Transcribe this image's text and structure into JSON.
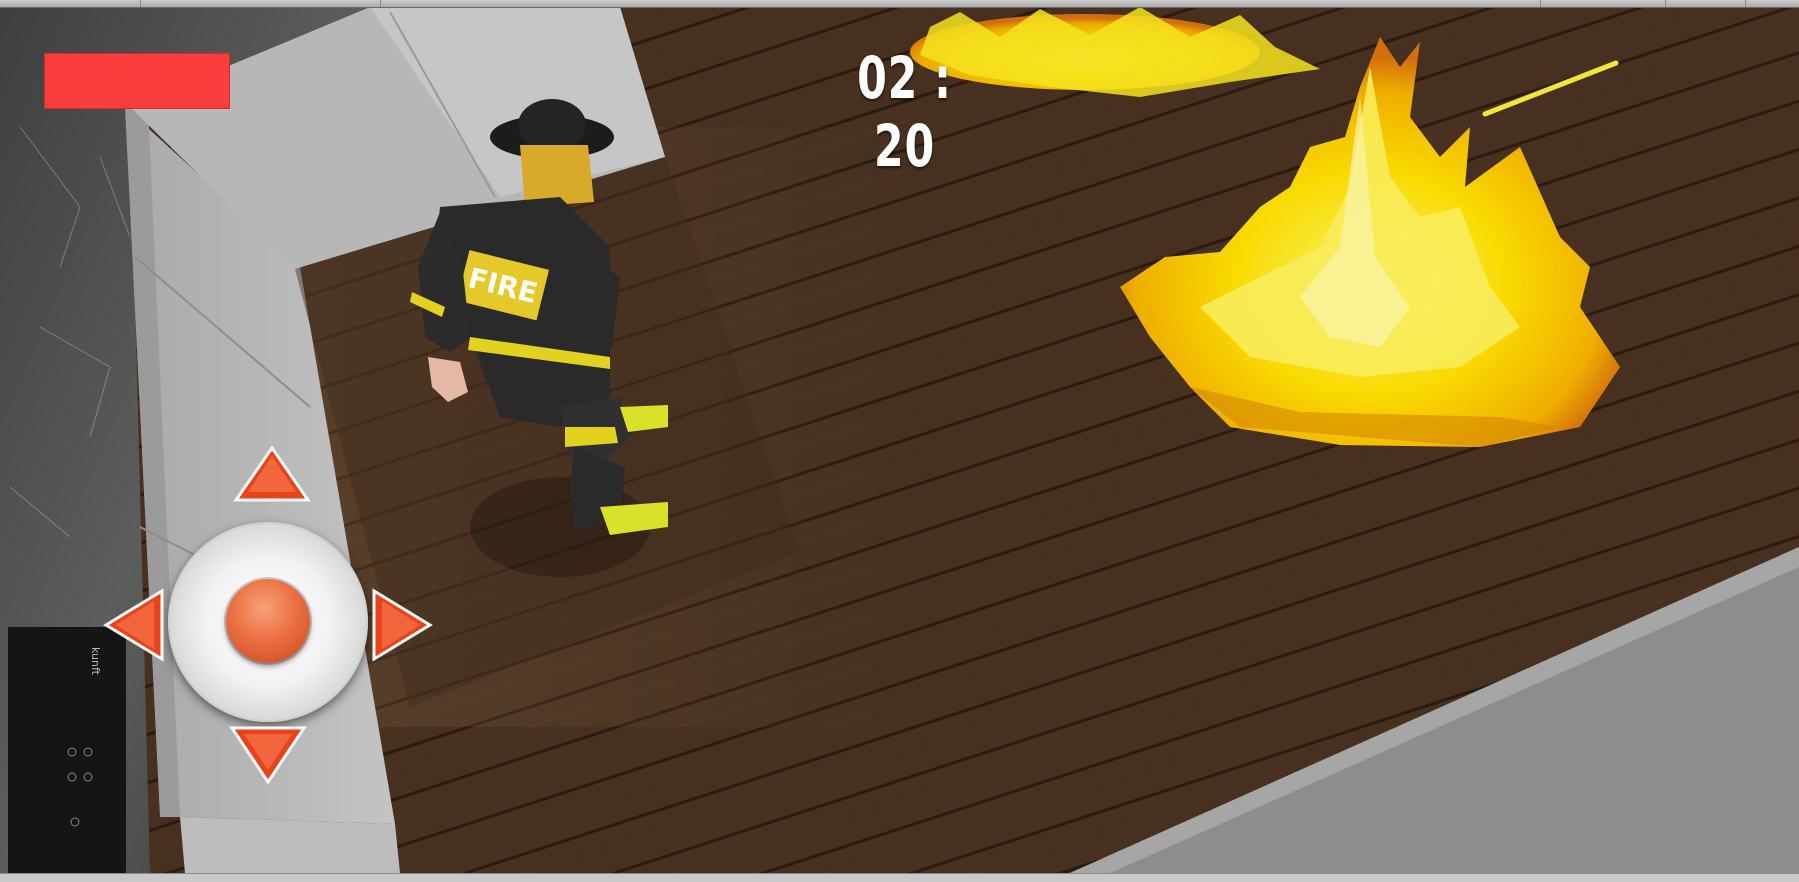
{
  "hud": {
    "timer": "02 : 20"
  },
  "character": {
    "jacket_text": "FIRE"
  },
  "scene": {
    "wall_panel_text": "kunft"
  },
  "controls": {
    "joystick": {
      "up_icon": "triangle-up-icon",
      "down_icon": "triangle-down-icon",
      "left_icon": "triangle-left-icon",
      "right_icon": "triangle-right-icon",
      "knob_icon": "orange-circle-icon"
    }
  },
  "colors": {
    "health": "#fa3c3c",
    "fire": "#ffe600",
    "arrow": "#e8441b",
    "floor": "#4a3327"
  }
}
